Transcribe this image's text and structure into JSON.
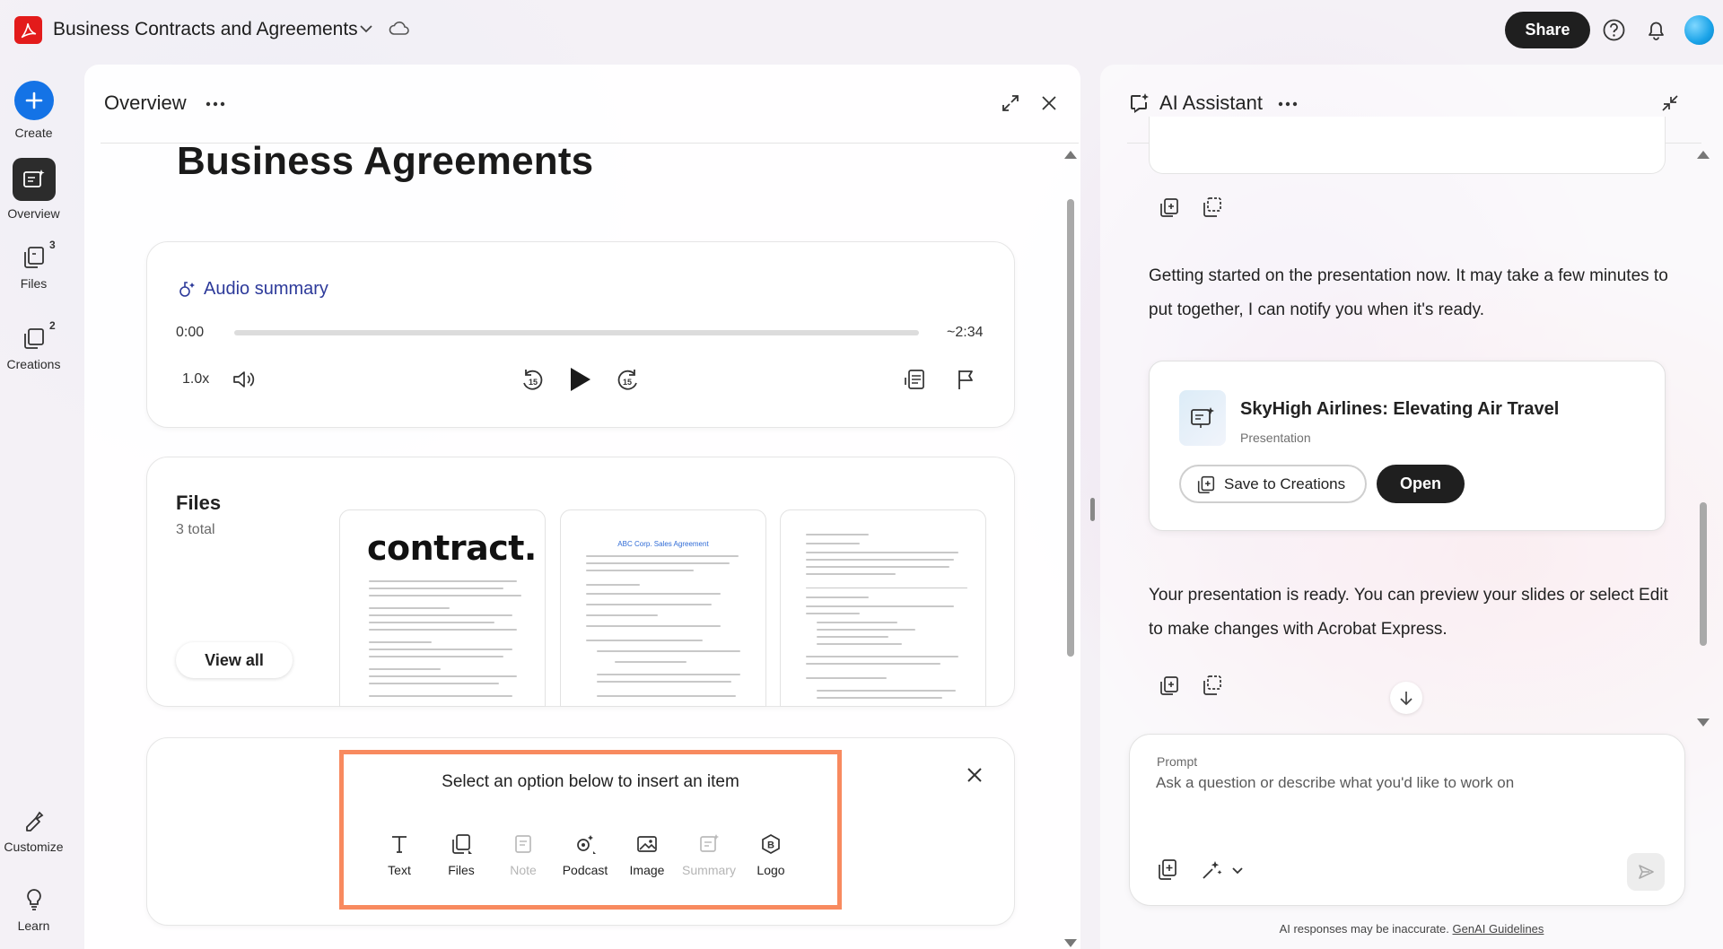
{
  "app": {
    "doc_title": "Business Contracts and Agreements",
    "share_label": "Share",
    "accent": "#1473e6",
    "brand_red": "#e31b1b"
  },
  "rail": {
    "create": "Create",
    "overview": "Overview",
    "files": {
      "label": "Files",
      "badge": "3"
    },
    "creations": {
      "label": "Creations",
      "badge": "2"
    },
    "customize": "Customize",
    "learn": "Learn"
  },
  "overview": {
    "header": "Overview",
    "title": "Business Agreements",
    "audio": {
      "title": "Audio summary",
      "time_start": "0:00",
      "time_end": "~2:34",
      "progress_fraction": 0,
      "speed": "1.0x"
    },
    "files": {
      "heading": "Files",
      "count": "3 total",
      "view_all": "View all",
      "thumb1_title": "contract.",
      "thumb2_title": "ABC Corp. Sales Agreement"
    },
    "insert": {
      "prompt": "Select an option below to insert an item",
      "options": [
        {
          "label": "Text",
          "enabled": true
        },
        {
          "label": "Files",
          "enabled": true
        },
        {
          "label": "Note",
          "enabled": false
        },
        {
          "label": "Podcast",
          "enabled": true
        },
        {
          "label": "Image",
          "enabled": true
        },
        {
          "label": "Summary",
          "enabled": false
        },
        {
          "label": "Logo",
          "enabled": true
        }
      ]
    }
  },
  "assistant": {
    "header": "AI Assistant",
    "msg1": "Getting started on the presentation now. It may take a few minutes to put together, I can notify you when it's ready.",
    "creation": {
      "title": "SkyHigh Airlines: Elevating Air Travel",
      "type": "Presentation",
      "save_label": "Save to Creations",
      "open_label": "Open"
    },
    "msg2": "Your presentation is ready. You can preview your slides or select Edit to make changes with Acrobat Express.",
    "prompt": {
      "label": "Prompt",
      "placeholder": "Ask a question or describe what you'd like to work on"
    },
    "disclaimer": "AI responses may be inaccurate.",
    "guidelines_link": "GenAI Guidelines"
  }
}
